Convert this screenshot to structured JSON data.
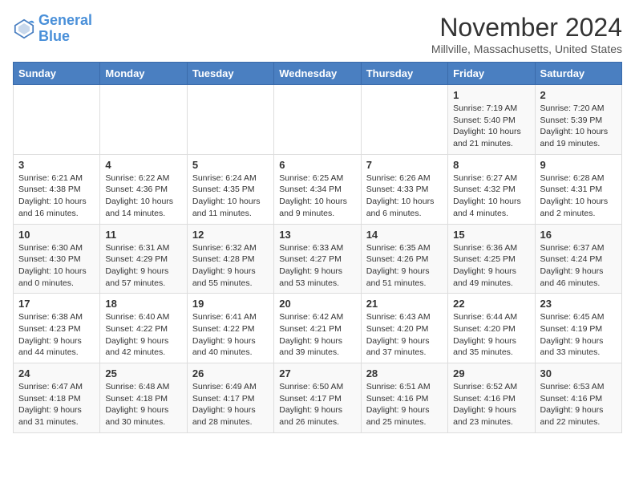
{
  "header": {
    "logo_line1": "General",
    "logo_line2": "Blue",
    "month_year": "November 2024",
    "location": "Millville, Massachusetts, United States"
  },
  "days_of_week": [
    "Sunday",
    "Monday",
    "Tuesday",
    "Wednesday",
    "Thursday",
    "Friday",
    "Saturday"
  ],
  "weeks": [
    [
      {
        "day": "",
        "info": ""
      },
      {
        "day": "",
        "info": ""
      },
      {
        "day": "",
        "info": ""
      },
      {
        "day": "",
        "info": ""
      },
      {
        "day": "",
        "info": ""
      },
      {
        "day": "1",
        "info": "Sunrise: 7:19 AM\nSunset: 5:40 PM\nDaylight: 10 hours and 21 minutes."
      },
      {
        "day": "2",
        "info": "Sunrise: 7:20 AM\nSunset: 5:39 PM\nDaylight: 10 hours and 19 minutes."
      }
    ],
    [
      {
        "day": "3",
        "info": "Sunrise: 6:21 AM\nSunset: 4:38 PM\nDaylight: 10 hours and 16 minutes."
      },
      {
        "day": "4",
        "info": "Sunrise: 6:22 AM\nSunset: 4:36 PM\nDaylight: 10 hours and 14 minutes."
      },
      {
        "day": "5",
        "info": "Sunrise: 6:24 AM\nSunset: 4:35 PM\nDaylight: 10 hours and 11 minutes."
      },
      {
        "day": "6",
        "info": "Sunrise: 6:25 AM\nSunset: 4:34 PM\nDaylight: 10 hours and 9 minutes."
      },
      {
        "day": "7",
        "info": "Sunrise: 6:26 AM\nSunset: 4:33 PM\nDaylight: 10 hours and 6 minutes."
      },
      {
        "day": "8",
        "info": "Sunrise: 6:27 AM\nSunset: 4:32 PM\nDaylight: 10 hours and 4 minutes."
      },
      {
        "day": "9",
        "info": "Sunrise: 6:28 AM\nSunset: 4:31 PM\nDaylight: 10 hours and 2 minutes."
      }
    ],
    [
      {
        "day": "10",
        "info": "Sunrise: 6:30 AM\nSunset: 4:30 PM\nDaylight: 10 hours and 0 minutes."
      },
      {
        "day": "11",
        "info": "Sunrise: 6:31 AM\nSunset: 4:29 PM\nDaylight: 9 hours and 57 minutes."
      },
      {
        "day": "12",
        "info": "Sunrise: 6:32 AM\nSunset: 4:28 PM\nDaylight: 9 hours and 55 minutes."
      },
      {
        "day": "13",
        "info": "Sunrise: 6:33 AM\nSunset: 4:27 PM\nDaylight: 9 hours and 53 minutes."
      },
      {
        "day": "14",
        "info": "Sunrise: 6:35 AM\nSunset: 4:26 PM\nDaylight: 9 hours and 51 minutes."
      },
      {
        "day": "15",
        "info": "Sunrise: 6:36 AM\nSunset: 4:25 PM\nDaylight: 9 hours and 49 minutes."
      },
      {
        "day": "16",
        "info": "Sunrise: 6:37 AM\nSunset: 4:24 PM\nDaylight: 9 hours and 46 minutes."
      }
    ],
    [
      {
        "day": "17",
        "info": "Sunrise: 6:38 AM\nSunset: 4:23 PM\nDaylight: 9 hours and 44 minutes."
      },
      {
        "day": "18",
        "info": "Sunrise: 6:40 AM\nSunset: 4:22 PM\nDaylight: 9 hours and 42 minutes."
      },
      {
        "day": "19",
        "info": "Sunrise: 6:41 AM\nSunset: 4:22 PM\nDaylight: 9 hours and 40 minutes."
      },
      {
        "day": "20",
        "info": "Sunrise: 6:42 AM\nSunset: 4:21 PM\nDaylight: 9 hours and 39 minutes."
      },
      {
        "day": "21",
        "info": "Sunrise: 6:43 AM\nSunset: 4:20 PM\nDaylight: 9 hours and 37 minutes."
      },
      {
        "day": "22",
        "info": "Sunrise: 6:44 AM\nSunset: 4:20 PM\nDaylight: 9 hours and 35 minutes."
      },
      {
        "day": "23",
        "info": "Sunrise: 6:45 AM\nSunset: 4:19 PM\nDaylight: 9 hours and 33 minutes."
      }
    ],
    [
      {
        "day": "24",
        "info": "Sunrise: 6:47 AM\nSunset: 4:18 PM\nDaylight: 9 hours and 31 minutes."
      },
      {
        "day": "25",
        "info": "Sunrise: 6:48 AM\nSunset: 4:18 PM\nDaylight: 9 hours and 30 minutes."
      },
      {
        "day": "26",
        "info": "Sunrise: 6:49 AM\nSunset: 4:17 PM\nDaylight: 9 hours and 28 minutes."
      },
      {
        "day": "27",
        "info": "Sunrise: 6:50 AM\nSunset: 4:17 PM\nDaylight: 9 hours and 26 minutes."
      },
      {
        "day": "28",
        "info": "Sunrise: 6:51 AM\nSunset: 4:16 PM\nDaylight: 9 hours and 25 minutes."
      },
      {
        "day": "29",
        "info": "Sunrise: 6:52 AM\nSunset: 4:16 PM\nDaylight: 9 hours and 23 minutes."
      },
      {
        "day": "30",
        "info": "Sunrise: 6:53 AM\nSunset: 4:16 PM\nDaylight: 9 hours and 22 minutes."
      }
    ]
  ]
}
